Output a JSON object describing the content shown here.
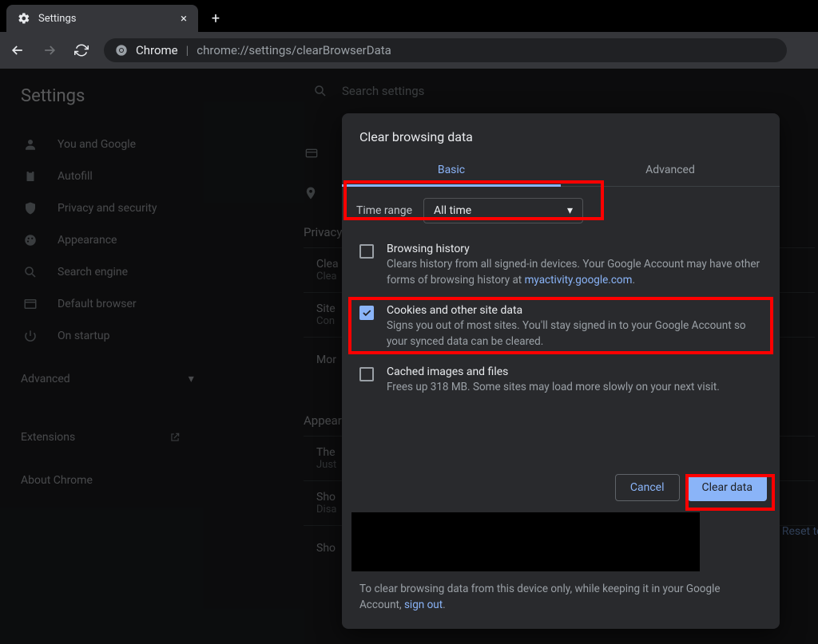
{
  "tab": {
    "title": "Settings"
  },
  "omnibox": {
    "prefix": "Chrome",
    "url": "chrome://settings/clearBrowserData"
  },
  "sidebar": {
    "heading": "Settings",
    "items": [
      {
        "label": "You and Google"
      },
      {
        "label": "Autofill"
      },
      {
        "label": "Privacy and security"
      },
      {
        "label": "Appearance"
      },
      {
        "label": "Search engine"
      },
      {
        "label": "Default browser"
      },
      {
        "label": "On startup"
      }
    ],
    "advanced": "Advanced",
    "extensions": "Extensions",
    "about": "About Chrome"
  },
  "search": {
    "placeholder": "Search settings"
  },
  "bg": {
    "privacy_heading": "Privacy",
    "rows": [
      {
        "title": "Clea",
        "sub": "Clea"
      },
      {
        "title": "Site",
        "sub": "Con"
      },
      {
        "title": "Mor",
        "sub": ""
      }
    ],
    "appearance_heading": "Appear",
    "app_rows": [
      {
        "title": "The",
        "sub": "Just"
      },
      {
        "title": "Sho",
        "sub": "Disa"
      },
      {
        "title": "Sho",
        "sub": ""
      }
    ],
    "reset": "Reset to"
  },
  "dialog": {
    "title": "Clear browsing data",
    "tabs": {
      "basic": "Basic",
      "advanced": "Advanced"
    },
    "time_range_label": "Time range",
    "time_range_value": "All time",
    "options": [
      {
        "title": "Browsing history",
        "desc_pre": "Clears history from all signed-in devices. Your Google Account may have other forms of browsing history at ",
        "desc_link": "myactivity.google.com",
        "desc_post": ".",
        "checked": false
      },
      {
        "title": "Cookies and other site data",
        "desc_pre": "Signs you out of most sites. You'll stay signed in to your Google Account so your synced data can be cleared.",
        "desc_link": "",
        "desc_post": "",
        "checked": true
      },
      {
        "title": "Cached images and files",
        "desc_pre": "Frees up 318 MB. Some sites may load more slowly on your next visit.",
        "desc_link": "",
        "desc_post": "",
        "checked": false
      }
    ],
    "cancel": "Cancel",
    "confirm": "Clear data",
    "footer_pre": "To clear browsing data from this device only, while keeping it in your Google Account, ",
    "footer_link": "sign out",
    "footer_post": "."
  }
}
